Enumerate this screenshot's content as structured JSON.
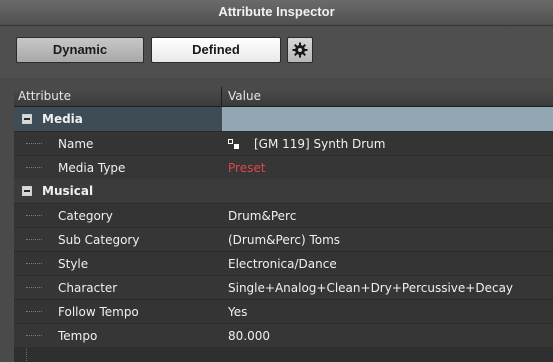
{
  "window": {
    "title": "Attribute Inspector"
  },
  "toolbar": {
    "dynamic_label": "Dynamic",
    "defined_label": "Defined",
    "settings_icon": "gear-icon"
  },
  "table": {
    "columns": [
      "Attribute",
      "Value"
    ],
    "groups": [
      {
        "name": "Media",
        "selected": true,
        "items": [
          {
            "attribute": "Name",
            "value": "[GM 119] Synth Drum",
            "icon": "media-icon"
          },
          {
            "attribute": "Media Type",
            "value": "Preset",
            "value_color": "#e04848"
          }
        ]
      },
      {
        "name": "Musical",
        "items": [
          {
            "attribute": "Category",
            "value": "Drum&Perc"
          },
          {
            "attribute": "Sub Category",
            "value": "(Drum&Perc) Toms"
          },
          {
            "attribute": "Style",
            "value": "Electronica/Dance"
          },
          {
            "attribute": "Character",
            "value": "Single+Analog+Clean+Dry+Percussive+Decay"
          },
          {
            "attribute": "Follow Tempo",
            "value": "Yes"
          },
          {
            "attribute": "Tempo",
            "value": "80.000"
          }
        ]
      }
    ]
  },
  "colors": {
    "selected_row": "#93a6b3",
    "preset_red": "#e04848",
    "background": "#4a4a4a"
  }
}
